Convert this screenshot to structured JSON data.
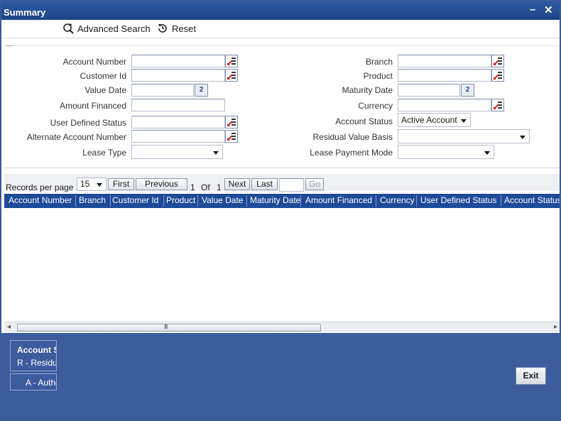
{
  "window": {
    "title": "Summary",
    "minimize": "–",
    "close": "✕"
  },
  "toolbar": {
    "advanced_search": "Advanced Search",
    "reset": "Reset"
  },
  "form": {
    "left": [
      {
        "label": "Account Number",
        "value": ""
      },
      {
        "label": "Customer Id",
        "value": ""
      },
      {
        "label": "Value Date",
        "value": ""
      },
      {
        "label": "Amount Financed",
        "value": ""
      },
      {
        "label": "User Defined Status",
        "value": ""
      },
      {
        "label": "Alternate Account Number",
        "value": ""
      },
      {
        "label": "Lease Type",
        "value": ""
      }
    ],
    "right": [
      {
        "label": "Branch",
        "value": ""
      },
      {
        "label": "Product",
        "value": ""
      },
      {
        "label": "Maturity Date",
        "value": ""
      },
      {
        "label": "Currency",
        "value": ""
      },
      {
        "label": "Account Status",
        "value": "Active Account"
      },
      {
        "label": "Residual Value Basis",
        "value": ""
      },
      {
        "label": "Lease Payment Mode",
        "value": ""
      }
    ],
    "calendar_glyph": "2"
  },
  "pager": {
    "records_label": "Records per page",
    "per_page": "15",
    "first": "First",
    "previous": "Previous",
    "current_page": "1",
    "of": "Of",
    "total_pages": "1",
    "next": "Next",
    "last": "Last",
    "go": "Go"
  },
  "grid": {
    "columns": [
      "Account Number",
      "Branch",
      "Customer Id",
      "Product",
      "Value Date",
      "Maturity Date",
      "Amount Financed",
      "Currency",
      "User Defined Status",
      "Account Status"
    ]
  },
  "scrollbar": {
    "grip": "III"
  },
  "footer": {
    "legend_title": "Account S",
    "legend_line": "R - Residu",
    "legend_status": "A - Autho",
    "exit": "Exit"
  },
  "colors": {
    "title_bar": "#2f5ba3",
    "grid_header": "#1e4a99",
    "footer": "#3c5c9e"
  }
}
